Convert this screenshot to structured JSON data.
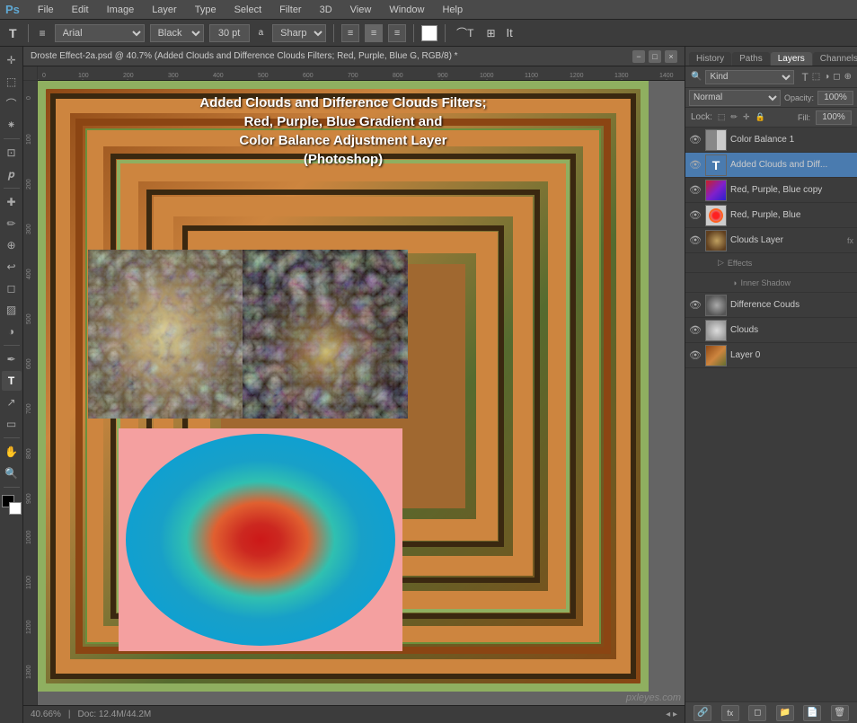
{
  "app": {
    "logo": "Ps",
    "menu_items": [
      "File",
      "Edit",
      "Image",
      "Layer",
      "Type",
      "Select",
      "Filter",
      "3D",
      "View",
      "Window",
      "Help"
    ]
  },
  "toolbar": {
    "type_icon": "T",
    "font_name": "Arial",
    "font_style": "Black",
    "font_size": "30 pt",
    "aa_label": "a",
    "aa_mode": "Sharp",
    "color_label": "color-white",
    "t_label": "It"
  },
  "document": {
    "title": "Droste Effect-2a.psd @ 40.7% (Added Clouds and Difference Clouds Filters; Red, Purple, Blue G, RGB/8) *",
    "min_btn": "−",
    "max_btn": "□",
    "close_btn": "×"
  },
  "canvas": {
    "title_text": "Added Clouds and Difference Clouds Filters;\nRed, Purple, Blue Gradient and\nColor Balance Adjustment Layer\n(Photoshop)",
    "zoom": "40.66%",
    "doc_size": "Doc: 12.4M/44.2M"
  },
  "right_panel": {
    "tabs": [
      "History",
      "Paths",
      "Layers",
      "Channels"
    ],
    "active_tab": "Layers",
    "search_kind": "Kind",
    "blend_mode": "Normal",
    "opacity_label": "Opacity:",
    "opacity_value": "100%",
    "lock_label": "Lock:",
    "fill_label": "Fill:",
    "fill_value": "100%",
    "layers": [
      {
        "id": "color-balance-1",
        "name": "Color Balance 1",
        "visible": true,
        "type": "adjustment",
        "selected": false
      },
      {
        "id": "added-clouds",
        "name": "Added Clouds and Diff...",
        "visible": true,
        "type": "text",
        "selected": true
      },
      {
        "id": "red-purple-blue-copy",
        "name": "Red, Purple, Blue copy",
        "visible": true,
        "type": "gradient",
        "selected": false
      },
      {
        "id": "red-purple-blue",
        "name": "Red, Purple, Blue",
        "visible": true,
        "type": "circle",
        "selected": false
      },
      {
        "id": "clouds-layer",
        "name": "Clouds Layer",
        "visible": true,
        "type": "clouds",
        "selected": false,
        "has_fx": true,
        "sub_items": [
          {
            "label": "Effects"
          },
          {
            "label": "Inner Shadow",
            "indent": true
          }
        ]
      },
      {
        "id": "difference-clouds",
        "name": "Difference Couds",
        "visible": true,
        "type": "diff-clouds",
        "selected": false
      },
      {
        "id": "clouds",
        "name": "Clouds",
        "visible": true,
        "type": "clouds-only",
        "selected": false
      },
      {
        "id": "layer-0",
        "name": "Layer 0",
        "visible": true,
        "type": "layer0",
        "selected": false
      }
    ],
    "bottom_buttons": [
      "fx",
      "◻",
      "◫",
      "🗑"
    ]
  },
  "watermark": "pxleyes.com"
}
